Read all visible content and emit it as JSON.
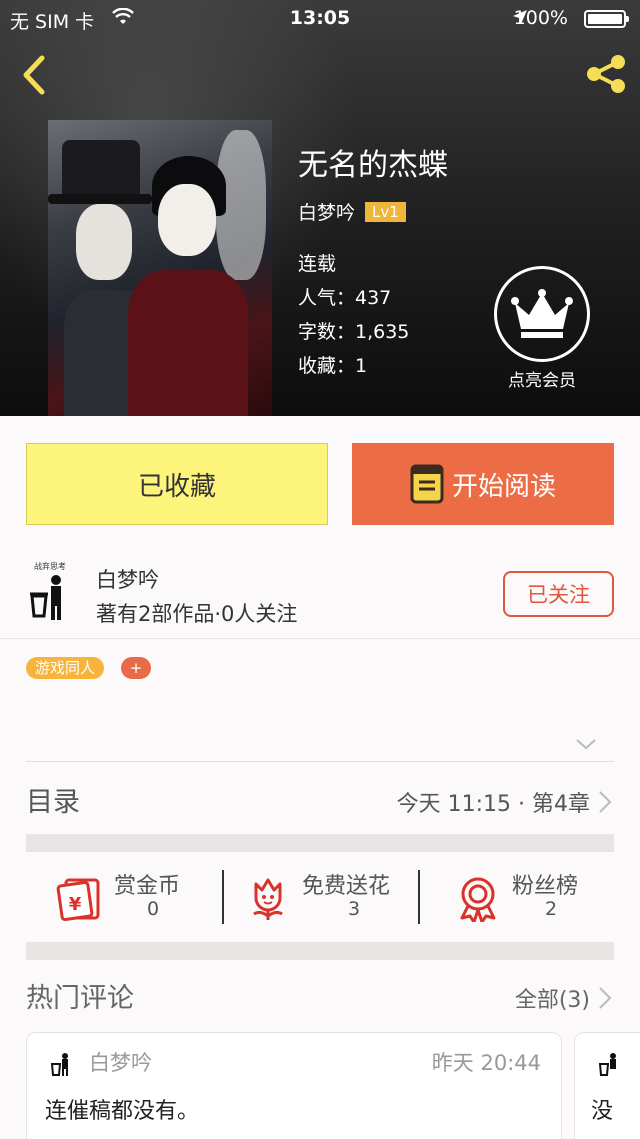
{
  "status_bar": {
    "carrier": "无 SIM 卡",
    "time": "13:05",
    "battery": "100%"
  },
  "book": {
    "title": "无名的杰蝶",
    "author": "白梦吟",
    "level": "Lv1",
    "status": "连载",
    "popularity": "人气：437",
    "word_count": "字数：1,635",
    "favorites": "收藏：1"
  },
  "vip": {
    "label": "点亮会员"
  },
  "actions": {
    "favorited_label": "已收藏",
    "start_reading_label": "开始阅读"
  },
  "author_card": {
    "name": "白梦吟",
    "stats": "著有2部作品·0人关注",
    "follow_label": "已关注",
    "avatar_caption": "战弃思考"
  },
  "tags": [
    "游戏同人"
  ],
  "tag_add": "+",
  "toc": {
    "title": "目录",
    "latest": "今天 11:15 · 第4章"
  },
  "stats": [
    {
      "label": "赏金币",
      "value": "0",
      "icon": "red-envelope-icon"
    },
    {
      "label": "免费送花",
      "value": "3",
      "icon": "flower-icon"
    },
    {
      "label": "粉丝榜",
      "value": "2",
      "icon": "rosette-icon"
    }
  ],
  "comments_section": {
    "title": "热门评论",
    "all_label": "全部(3)"
  },
  "comments": [
    {
      "user": "白梦吟",
      "time": "昨天 20:44",
      "text": "连催稿都没有。"
    },
    {
      "text": "没"
    }
  ],
  "colors": {
    "accent_yellow": "#fdf47b",
    "accent_orange": "#ec6d45",
    "follow_red": "#e0573d",
    "tag_yellow": "#f6b43c",
    "icon_gold": "#f5dd55",
    "icon_red": "#d8322a"
  }
}
